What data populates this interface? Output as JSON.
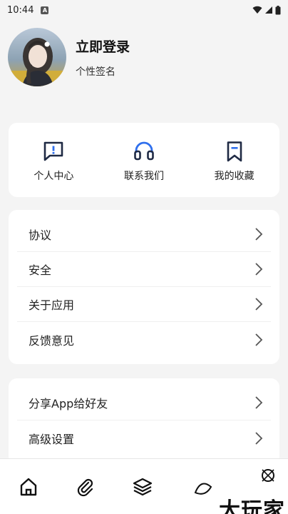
{
  "status_bar": {
    "time": "10:44",
    "notification_icon": "a-app-icon",
    "icons": [
      "wifi-icon",
      "signal-icon",
      "battery-icon"
    ]
  },
  "profile": {
    "login_title": "立即登录",
    "signature": "个性签名"
  },
  "quick_actions": [
    {
      "label": "个人中心",
      "icon": "message-alert-icon"
    },
    {
      "label": "联系我们",
      "icon": "headset-icon"
    },
    {
      "label": "我的收藏",
      "icon": "bookmark-icon"
    }
  ],
  "menu_group_1": [
    {
      "label": "协议"
    },
    {
      "label": "安全"
    },
    {
      "label": "关于应用"
    },
    {
      "label": "反馈意见"
    }
  ],
  "menu_group_2": [
    {
      "label": "分享App给好友"
    },
    {
      "label": "高级设置"
    }
  ],
  "bottom_nav": [
    {
      "icon": "home-icon"
    },
    {
      "icon": "paperclip-icon"
    },
    {
      "icon": "layers-icon"
    }
  ],
  "watermark": {
    "text": "大玩家"
  },
  "colors": {
    "background": "#f4f4f4",
    "card": "#ffffff",
    "accent_blue": "#2f6fed",
    "icon_dark": "#1f2a44"
  }
}
